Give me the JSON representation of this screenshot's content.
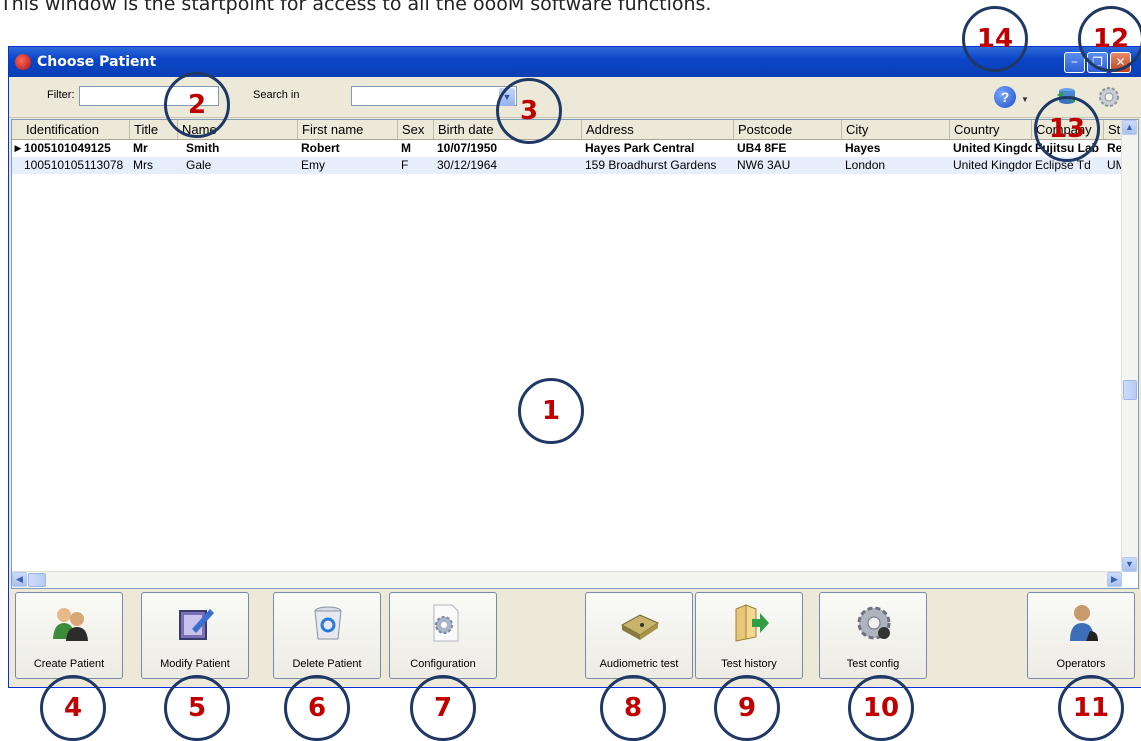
{
  "caption": "This window is the startpoint for access to all the oooM software functions.",
  "window": {
    "title": "Choose Patient",
    "controls": [
      "minimize",
      "restore",
      "close"
    ]
  },
  "toolbar": {
    "filter_label": "Filter:",
    "filter_value": "",
    "search_label": "Search in",
    "search_value": "",
    "icons": [
      "help-icon",
      "sync-database-icon",
      "settings-gear-icon"
    ]
  },
  "table": {
    "columns": [
      "Identification",
      "Title",
      "Name",
      "First name",
      "Sex",
      "Birth date",
      "Address",
      "Postcode",
      "City",
      "Country",
      "Company",
      "St"
    ],
    "rows": [
      {
        "selected": true,
        "cells": [
          "1005101049125",
          "Mr",
          "Smith",
          "Robert",
          "M",
          "10/07/1950",
          "Hayes Park Central",
          "UB4 8FE",
          "Hayes",
          "United Kingdom",
          "Fujitsu Lab",
          "Re"
        ]
      },
      {
        "selected": false,
        "cells": [
          "100510105113078",
          "Mrs",
          "Gale",
          "Emy",
          "F",
          "30/12/1964",
          "159 Broadhurst Gardens",
          "NW6 3AU",
          "London",
          "United Kingdom",
          "Eclipse Td",
          "UMa"
        ]
      }
    ]
  },
  "buttons": [
    {
      "id": "create",
      "label": "Create Patient",
      "icon": "users-icon"
    },
    {
      "id": "modify",
      "label": "Modify Patient",
      "icon": "edit-tablet-icon"
    },
    {
      "id": "delete",
      "label": "Delete Patient",
      "icon": "recycle-bin-icon"
    },
    {
      "id": "configuration",
      "label": "Configuration",
      "icon": "config-document-gear-icon"
    },
    {
      "id": "audiometric",
      "label": "Audiometric test",
      "icon": "audiometer-icon"
    },
    {
      "id": "history",
      "label": "Test history",
      "icon": "folder-arrow-icon"
    },
    {
      "id": "testconfig",
      "label": "Test config",
      "icon": "gears-icon"
    },
    {
      "id": "operators",
      "label": "Operators",
      "icon": "operator-person-icon"
    }
  ],
  "callouts": [
    "1",
    "2",
    "3",
    "4",
    "5",
    "6",
    "7",
    "8",
    "9",
    "10",
    "11",
    "12",
    "13",
    "14"
  ],
  "colors": {
    "callout_number": "#c00000",
    "callout_circle": "#1f3864",
    "titlebar": "#0a46c8"
  }
}
